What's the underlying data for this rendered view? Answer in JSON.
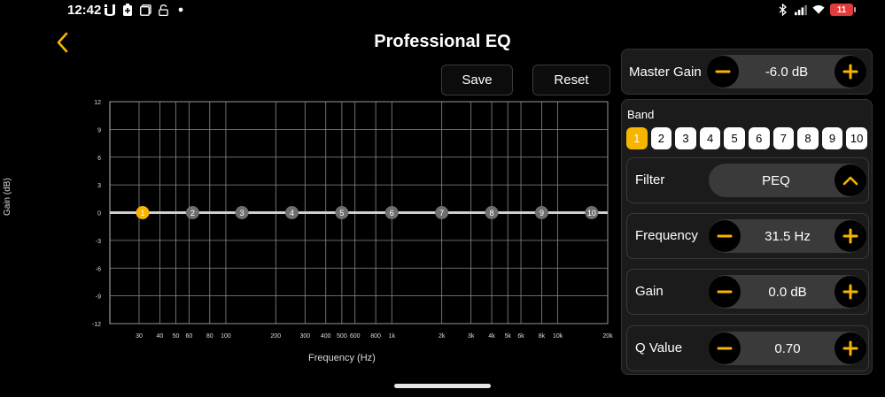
{
  "status_bar": {
    "time": "12:42",
    "battery_level": "11",
    "left_icons": [
      "notification-u-icon",
      "battery-saver-icon",
      "screenshot-icon",
      "lock-icon",
      "dot-icon"
    ],
    "right_icons": [
      "bluetooth-icon",
      "signal-icon",
      "wifi-icon"
    ]
  },
  "header": {
    "title": "Professional EQ",
    "save_label": "Save",
    "reset_label": "Reset",
    "accent_color": "#f7b500"
  },
  "chart_data": {
    "type": "line",
    "title": "",
    "xlabel": "Frequency (Hz)",
    "ylabel": "Gain (dB)",
    "x_scale": "log",
    "xlim": [
      20,
      20000
    ],
    "ylim": [
      -12,
      12
    ],
    "grid": true,
    "x_ticks": [
      {
        "v": 30,
        "label": "30"
      },
      {
        "v": 40,
        "label": "40"
      },
      {
        "v": 50,
        "label": "50"
      },
      {
        "v": 60,
        "label": "60"
      },
      {
        "v": 80,
        "label": "80"
      },
      {
        "v": 100,
        "label": "100"
      },
      {
        "v": 200,
        "label": "200"
      },
      {
        "v": 300,
        "label": "300"
      },
      {
        "v": 400,
        "label": "400"
      },
      {
        "v": 500,
        "label": "500"
      },
      {
        "v": 600,
        "label": "600"
      },
      {
        "v": 800,
        "label": "800"
      },
      {
        "v": 1000,
        "label": "1k"
      },
      {
        "v": 2000,
        "label": "2k"
      },
      {
        "v": 3000,
        "label": "3k"
      },
      {
        "v": 4000,
        "label": "4k"
      },
      {
        "v": 5000,
        "label": "5k"
      },
      {
        "v": 6000,
        "label": "6k"
      },
      {
        "v": 8000,
        "label": "8k"
      },
      {
        "v": 10000,
        "label": "10k"
      },
      {
        "v": 20000,
        "label": "20k"
      }
    ],
    "y_ticks": [
      12,
      9,
      6,
      3,
      0,
      -3,
      -6,
      -9,
      -12
    ],
    "curve": {
      "x": [
        20,
        20000
      ],
      "y": [
        0,
        0
      ]
    },
    "bands": [
      {
        "label": "1",
        "freq": 31.5,
        "gain": 0,
        "active": true
      },
      {
        "label": "2",
        "freq": 63,
        "gain": 0,
        "active": false
      },
      {
        "label": "3",
        "freq": 125,
        "gain": 0,
        "active": false
      },
      {
        "label": "4",
        "freq": 250,
        "gain": 0,
        "active": false
      },
      {
        "label": "5",
        "freq": 500,
        "gain": 0,
        "active": false
      },
      {
        "label": "6",
        "freq": 1000,
        "gain": 0,
        "active": false
      },
      {
        "label": "7",
        "freq": 2000,
        "gain": 0,
        "active": false
      },
      {
        "label": "8",
        "freq": 4000,
        "gain": 0,
        "active": false
      },
      {
        "label": "9",
        "freq": 8000,
        "gain": 0,
        "active": false
      },
      {
        "label": "10",
        "freq": 16000,
        "gain": 0,
        "active": false
      }
    ]
  },
  "master_gain": {
    "label": "Master Gain",
    "value": "-6.0  dB"
  },
  "band_panel": {
    "title": "Band",
    "bands": [
      "1",
      "2",
      "3",
      "4",
      "5",
      "6",
      "7",
      "8",
      "9",
      "10"
    ],
    "selected": "1",
    "filter": {
      "label": "Filter",
      "value": "PEQ"
    },
    "frequency": {
      "label": "Frequency",
      "value": "31.5  Hz"
    },
    "gain": {
      "label": "Gain",
      "value": "0.0  dB"
    },
    "q_value": {
      "label": "Q Value",
      "value": "0.70"
    }
  }
}
